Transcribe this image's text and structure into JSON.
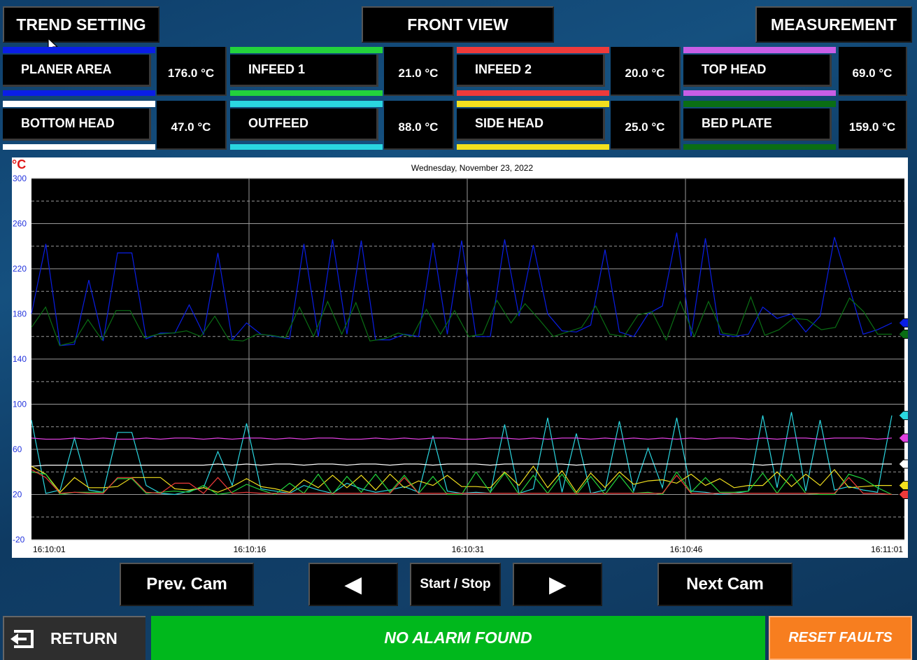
{
  "header": {
    "trend_setting": "TREND SETTING",
    "front_view": "FRONT VIEW",
    "measurement": "MEASUREMENT"
  },
  "sensors": [
    {
      "label": "PLANER AREA",
      "value": "176.0 °C",
      "color": "#0a1ee6"
    },
    {
      "label": "INFEED 1",
      "value": "21.0 °C",
      "color": "#23d23c"
    },
    {
      "label": "INFEED 2",
      "value": "20.0 °C",
      "color": "#ee3a3a"
    },
    {
      "label": "TOP HEAD",
      "value": "69.0 °C",
      "color": "#c85ee6"
    },
    {
      "label": "BOTTOM HEAD",
      "value": "47.0 °C",
      "color": "#ffffff"
    },
    {
      "label": "OUTFEED",
      "value": "88.0 °C",
      "color": "#2ad6e0"
    },
    {
      "label": "SIDE HEAD",
      "value": "25.0 °C",
      "color": "#f2e01e"
    },
    {
      "label": "BED PLATE",
      "value": "159.0 °C",
      "color": "#0a6e14"
    }
  ],
  "chart_data": {
    "type": "line",
    "unit_label": "°C",
    "title": "Wednesday, November 23, 2022",
    "ylim": [
      -20,
      300
    ],
    "y_ticks": [
      "300",
      "260",
      "220",
      "180",
      "140",
      "100",
      "60",
      "20",
      "-20"
    ],
    "x_ticks": [
      "16:10:01",
      "16:10:16",
      "16:10:31",
      "16:10:46",
      "16:11:01"
    ],
    "grid": true,
    "series": [
      {
        "color": "#0a1ee6",
        "values": [
          180,
          242,
          152,
          153,
          210,
          156,
          234,
          234,
          158,
          163,
          163,
          188,
          162,
          234,
          157,
          172,
          162,
          160,
          158,
          242,
          160,
          246,
          162,
          245,
          157,
          157,
          162,
          160,
          243,
          162,
          245,
          160,
          160,
          246,
          178,
          241,
          180,
          165,
          164,
          170,
          237,
          164,
          160,
          180,
          187,
          252,
          160,
          247,
          162,
          160,
          162,
          186,
          176,
          180,
          164,
          178,
          248,
          205,
          162,
          166,
          172
        ]
      },
      {
        "color": "#0a6e14",
        "values": [
          168,
          186,
          152,
          155,
          175,
          157,
          183,
          183,
          159,
          162,
          163,
          165,
          160,
          178,
          157,
          156,
          162,
          161,
          159,
          186,
          160,
          191,
          162,
          190,
          156,
          158,
          163,
          160,
          184,
          162,
          183,
          160,
          162,
          192,
          172,
          189,
          175,
          160,
          164,
          168,
          187,
          162,
          160,
          179,
          182,
          157,
          191,
          160,
          191,
          163,
          161,
          195,
          161,
          166,
          176,
          175,
          166,
          168,
          194,
          182,
          162,
          162
        ]
      },
      {
        "color": "#2ad6e0",
        "values": [
          86,
          21,
          24,
          70,
          24,
          22,
          75,
          75,
          28,
          21,
          20,
          23,
          26,
          58,
          28,
          83,
          25,
          23,
          21,
          28,
          24,
          21,
          30,
          25,
          22,
          24,
          27,
          22,
          72,
          23,
          21,
          22,
          21,
          82,
          21,
          25,
          88,
          22,
          74,
          21,
          24,
          85,
          23,
          61,
          26,
          88,
          23,
          22,
          20,
          21,
          23,
          90,
          26,
          93,
          23,
          86,
          24,
          27,
          24,
          22,
          90
        ]
      },
      {
        "color": "#e040e0",
        "values": [
          70,
          69,
          69,
          70,
          69,
          70,
          69,
          69,
          70,
          69,
          70,
          70,
          69,
          70,
          69,
          70,
          70,
          69,
          70,
          69,
          70,
          70,
          69,
          69,
          70,
          69,
          70,
          69,
          70,
          70,
          69,
          69,
          70,
          70,
          69,
          70,
          69,
          70,
          70,
          69,
          70,
          69,
          70,
          69,
          70,
          69,
          70,
          69,
          70,
          70,
          69,
          70,
          69,
          70,
          70,
          69,
          70,
          70,
          70,
          69,
          70
        ]
      },
      {
        "color": "#ffffff",
        "values": [
          45,
          46,
          46,
          46,
          46,
          46,
          46,
          46,
          46,
          46,
          46,
          46,
          46,
          47,
          46,
          47,
          46,
          47,
          47,
          46,
          47,
          47,
          46,
          47,
          47,
          46,
          47,
          47,
          46,
          47,
          47,
          47,
          46,
          47,
          47,
          47,
          47,
          47,
          46,
          47,
          47,
          47,
          47,
          47,
          47,
          47,
          47,
          47,
          47,
          47,
          47,
          46,
          47,
          47,
          47,
          47,
          47,
          47,
          47,
          47,
          47
        ]
      },
      {
        "color": "#f2e01e",
        "values": [
          45,
          38,
          22,
          35,
          26,
          26,
          27,
          35,
          35,
          35,
          25,
          24,
          26,
          22,
          27,
          34,
          27,
          25,
          22,
          33,
          26,
          37,
          26,
          37,
          24,
          38,
          26,
          32,
          28,
          37,
          27,
          27,
          26,
          40,
          28,
          45,
          26,
          41,
          22,
          39,
          26,
          40,
          29,
          32,
          33,
          30,
          38,
          28,
          34,
          26,
          28,
          28,
          40,
          27,
          38,
          28,
          42,
          26,
          27,
          28,
          28
        ]
      },
      {
        "color": "#23d23c",
        "values": [
          40,
          38,
          20,
          22,
          22,
          22,
          34,
          34,
          21,
          22,
          23,
          22,
          28,
          20,
          22,
          29,
          24,
          20,
          30,
          21,
          38,
          20,
          36,
          22,
          38,
          22,
          37,
          21,
          36,
          20,
          20,
          40,
          22,
          39,
          20,
          37,
          21,
          38,
          20,
          36,
          20,
          37,
          21,
          22,
          20,
          40,
          22,
          35,
          22,
          22,
          23,
          39,
          21,
          38,
          21,
          20,
          20,
          38,
          34,
          26,
          20
        ]
      },
      {
        "color": "#ee3a3a",
        "values": [
          42,
          35,
          21,
          22,
          21,
          21,
          35,
          35,
          22,
          21,
          30,
          30,
          21,
          35,
          21,
          22,
          21,
          21,
          21,
          21,
          21,
          21,
          21,
          21,
          21,
          21,
          35,
          21,
          21,
          21,
          21,
          21,
          21,
          21,
          21,
          21,
          21,
          21,
          21,
          21,
          21,
          21,
          21,
          21,
          21,
          37,
          21,
          21,
          21,
          21,
          21,
          21,
          21,
          21,
          21,
          21,
          21,
          35,
          21,
          21,
          20
        ]
      }
    ]
  },
  "controls": {
    "prev_cam": "Prev. Cam",
    "prev": "◀",
    "start_stop": "Start / Stop",
    "next": "▶",
    "next_cam": "Next Cam"
  },
  "footer": {
    "return": "RETURN",
    "status": "NO ALARM FOUND",
    "reset": "RESET FAULTS"
  }
}
